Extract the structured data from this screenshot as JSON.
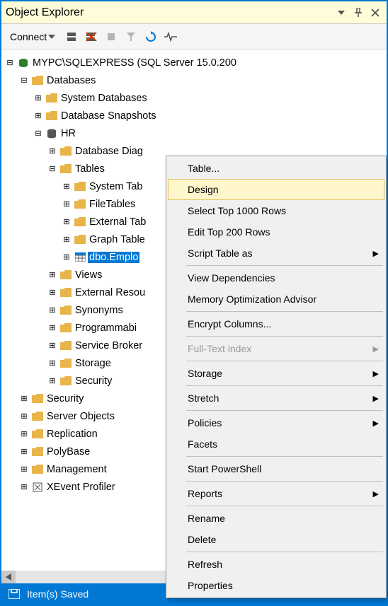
{
  "window": {
    "title": "Object Explorer"
  },
  "toolbar": {
    "connect_label": "Connect"
  },
  "tree": {
    "server": "MYPC\\SQLEXPRESS (SQL Server 15.0.200",
    "databases": "Databases",
    "sys_db": "System Databases",
    "db_snapshots": "Database Snapshots",
    "hr": "HR",
    "db_diagrams": "Database Diag",
    "tables": "Tables",
    "sys_tables": "System Tab",
    "file_tables": "FileTables",
    "ext_tables": "External Tab",
    "graph_tables": "Graph Table",
    "dbo_emplo": "dbo.Emplo",
    "views": "Views",
    "ext_resources": "External Resou",
    "synonyms": "Synonyms",
    "programmability": "Programmabi",
    "service_broker": "Service Broker",
    "storage": "Storage",
    "security_db": "Security",
    "security": "Security",
    "server_objects": "Server Objects",
    "replication": "Replication",
    "polybase": "PolyBase",
    "management": "Management",
    "xevent": "XEvent Profiler"
  },
  "menu": {
    "table": "Table...",
    "design": "Design",
    "select1000": "Select Top 1000 Rows",
    "edit200": "Edit Top 200 Rows",
    "script_as": "Script Table as",
    "view_deps": "View Dependencies",
    "mem_opt": "Memory Optimization Advisor",
    "encrypt": "Encrypt Columns...",
    "fulltext": "Full-Text index",
    "storage": "Storage",
    "stretch": "Stretch",
    "policies": "Policies",
    "facets": "Facets",
    "powershell": "Start PowerShell",
    "reports": "Reports",
    "rename": "Rename",
    "delete": "Delete",
    "refresh": "Refresh",
    "properties": "Properties"
  },
  "status": {
    "text": "Item(s) Saved"
  }
}
